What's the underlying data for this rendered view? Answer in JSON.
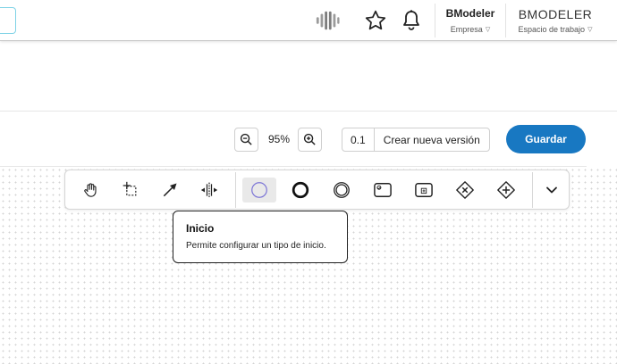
{
  "header": {
    "company": {
      "name": "BModeler",
      "label": "Empresa"
    },
    "workspace": {
      "name": "BMODELER",
      "label": "Espacio de trabajo"
    },
    "icons": [
      "brand-logo-icon",
      "star-icon",
      "bell-icon"
    ]
  },
  "editor": {
    "zoom_value": "95%",
    "version_number": "0.1",
    "new_version_label": "Crear nueva versión",
    "save_label": "Guardar"
  },
  "toolbar": {
    "tools": [
      {
        "id": "hand",
        "icon": "hand-icon"
      },
      {
        "id": "lasso",
        "icon": "lasso-select-icon"
      },
      {
        "id": "connect",
        "icon": "arrow-connect-icon"
      },
      {
        "id": "space",
        "icon": "space-tool-icon"
      },
      {
        "id": "start-event",
        "icon": "start-event-icon",
        "active": true
      },
      {
        "id": "end-event",
        "icon": "end-event-icon"
      },
      {
        "id": "intermediate-event",
        "icon": "intermediate-event-icon"
      },
      {
        "id": "task",
        "icon": "task-icon"
      },
      {
        "id": "subprocess",
        "icon": "subprocess-icon"
      },
      {
        "id": "exclusive-gateway",
        "icon": "exclusive-gateway-icon"
      },
      {
        "id": "parallel-gateway",
        "icon": "parallel-gateway-icon"
      },
      {
        "id": "more",
        "icon": "chevron-down-icon"
      }
    ]
  },
  "tooltip": {
    "title": "Inicio",
    "text": "Permite configurar un tipo de inicio."
  },
  "colors": {
    "primary": "#1878c2",
    "active_tool_bg": "#e9e9e9",
    "start_event_stroke": "#7b74d6"
  }
}
